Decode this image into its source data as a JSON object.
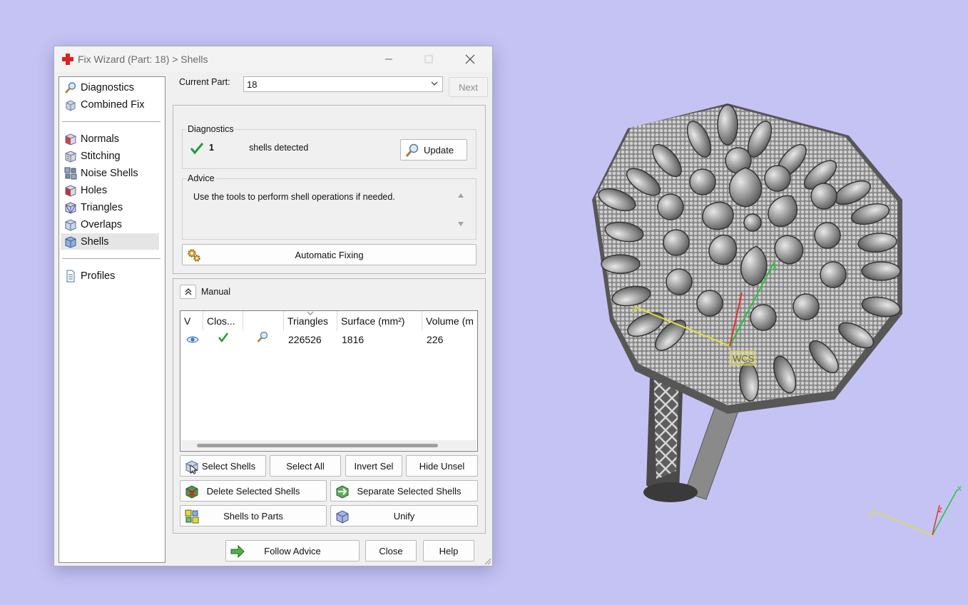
{
  "window": {
    "title": "Fix Wizard (Part: 18) > Shells",
    "controls": [
      "minimize-icon",
      "maximize-icon",
      "close-icon"
    ]
  },
  "nav": {
    "items": [
      {
        "label": "Diagnostics",
        "icon": "magnifier-icon"
      },
      {
        "label": "Combined Fix",
        "icon": "combined-fix-icon"
      },
      {
        "label": "Normals",
        "icon": "normals-cube-icon"
      },
      {
        "label": "Stitching",
        "icon": "stitching-cube-icon"
      },
      {
        "label": "Noise Shells",
        "icon": "noise-shells-icon"
      },
      {
        "label": "Holes",
        "icon": "holes-cube-icon"
      },
      {
        "label": "Triangles",
        "icon": "triangles-cube-icon"
      },
      {
        "label": "Overlaps",
        "icon": "overlaps-cube-icon"
      },
      {
        "label": "Shells",
        "icon": "shells-cube-icon"
      },
      {
        "label": "Profiles",
        "icon": "document-icon"
      }
    ],
    "active": "Shells"
  },
  "part": {
    "label": "Current Part:",
    "value": "18",
    "next_label": "Next"
  },
  "diagnostics": {
    "title": "Diagnostics",
    "count": "1",
    "text": "shells detected",
    "update_label": "Update"
  },
  "advice": {
    "title": "Advice",
    "text": "Use the tools to perform shell operations if needed."
  },
  "automatic_fixing_label": "Automatic Fixing",
  "manual": {
    "title": "Manual",
    "columns": [
      "V",
      "Clos...",
      "",
      "Triangles",
      "Surface (mm²)",
      "Volume (m"
    ],
    "rows": [
      {
        "visible_icon": "eye-icon",
        "closed_icon": "checkmark-icon",
        "zoom_icon": "magnifier-icon",
        "triangles": "226526",
        "surface": "1816",
        "volume": "226"
      }
    ]
  },
  "buttons": {
    "select_shells": "Select Shells",
    "select_all": "Select All",
    "invert_sel": "Invert Sel",
    "hide_unsel": "Hide Unsel",
    "delete_selected": "Delete Selected Shells",
    "separate_selected": "Separate Selected Shells",
    "shells_to_parts": "Shells to Parts",
    "unify": "Unify",
    "follow_advice": "Follow Advice",
    "close": "Close",
    "help": "Help"
  },
  "viewport": {
    "wcs_label": "WCS",
    "axes": [
      "x",
      "y",
      "z"
    ],
    "background": "#c5c3f3"
  }
}
